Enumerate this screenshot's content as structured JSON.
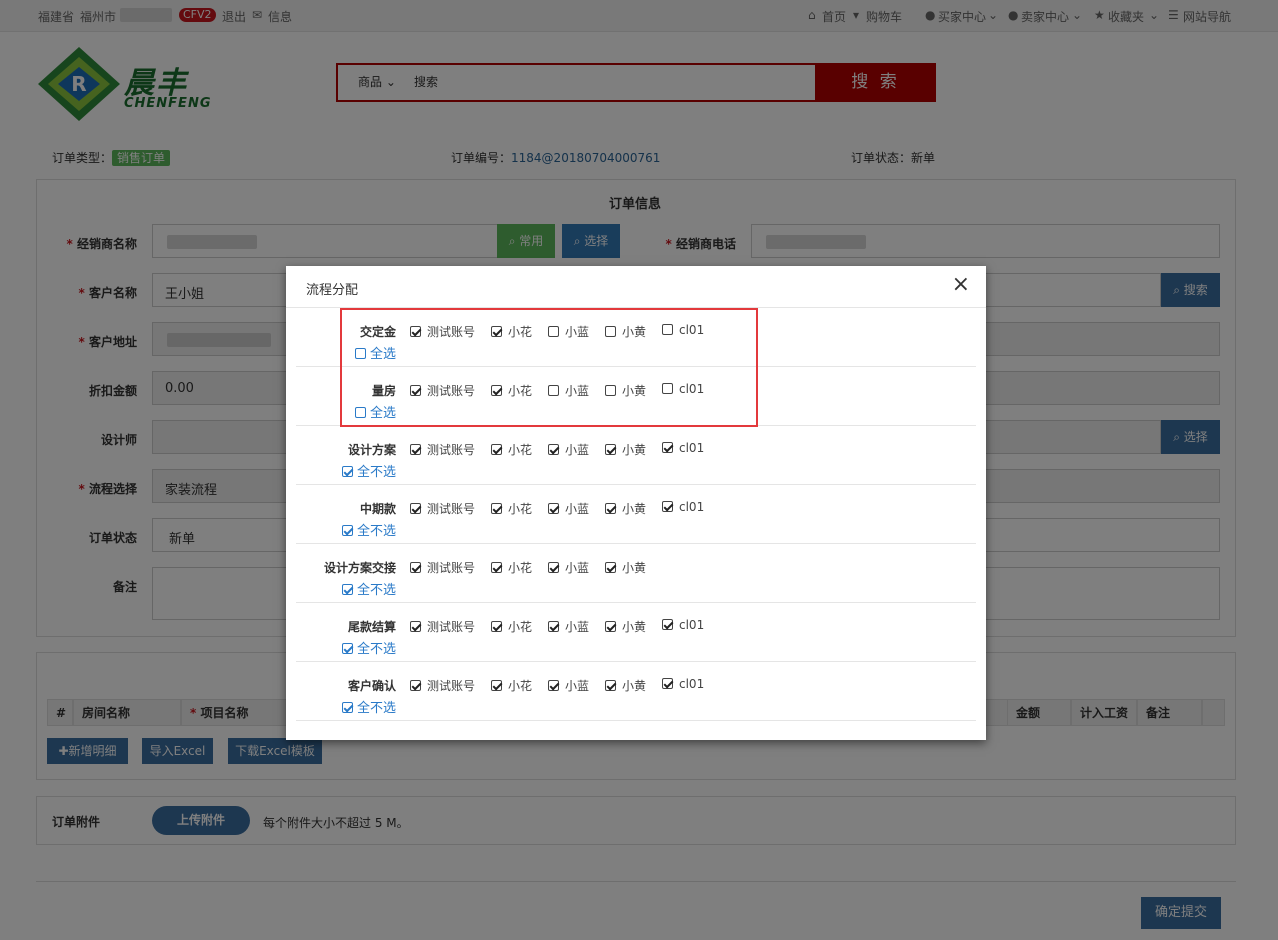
{
  "topbar": {
    "province": "福建省",
    "city": "福州市",
    "badge": "CFV2",
    "logout": "退出",
    "messages": "信息",
    "home": "首页",
    "cart": "购物车",
    "buyer": "买家中心",
    "seller": "卖家中心",
    "favorites": "收藏夹",
    "sitenav": "网站导航"
  },
  "brand": {
    "cn": "晨丰",
    "en": "CHENFENG"
  },
  "search": {
    "category": "商品",
    "placeholder": "搜索",
    "button": "搜 索"
  },
  "order_meta": {
    "type_label": "订单类型：",
    "type_value": "销售订单",
    "no_label": "订单编号：",
    "no_value": "1184@20180704000761",
    "status_label": "订单状态：",
    "status_value": "新单"
  },
  "form": {
    "section_title": "订单信息",
    "dealer_name": "经销商名称",
    "common_btn": "常用",
    "select_btn": "选择",
    "dealer_phone": "经销商电话",
    "customer_name": "客户名称",
    "customer_name_value": "王小姐",
    "search_btn": "搜索",
    "customer_addr": "客户地址",
    "discount": "折扣金额",
    "discount_value": "0.00",
    "designer": "设计师",
    "designer_btn": "选择",
    "flow": "流程选择",
    "flow_value": "家装流程",
    "status": "订单状态",
    "status_value": "新单",
    "remark": "备注"
  },
  "detail_table": {
    "headers": [
      "#",
      "房间名称",
      "项目名称",
      "金额",
      "计入工资",
      "备注"
    ],
    "add_btn": "新增明细",
    "import_btn": "导入Excel",
    "download_btn": "下载Excel模板"
  },
  "attachment": {
    "label": "订单附件",
    "upload_btn": "上传附件",
    "hint": "每个附件大小不超过 5 M。"
  },
  "submit_btn": "确定提交",
  "modal": {
    "title": "流程分配",
    "close": "×",
    "rows": [
      {
        "name": "交定金",
        "toggle": "全选",
        "toggle_on": false,
        "options": [
          {
            "label": "测试账号",
            "on": true
          },
          {
            "label": "小花",
            "on": true
          },
          {
            "label": "小蓝",
            "on": false
          },
          {
            "label": "小黄",
            "on": false
          },
          {
            "label": "cl01",
            "on": false
          }
        ]
      },
      {
        "name": "量房",
        "toggle": "全选",
        "toggle_on": false,
        "options": [
          {
            "label": "测试账号",
            "on": true
          },
          {
            "label": "小花",
            "on": true
          },
          {
            "label": "小蓝",
            "on": false
          },
          {
            "label": "小黄",
            "on": false
          },
          {
            "label": "cl01",
            "on": false
          }
        ]
      },
      {
        "name": "设计方案",
        "toggle": "全不选",
        "toggle_on": true,
        "options": [
          {
            "label": "测试账号",
            "on": true
          },
          {
            "label": "小花",
            "on": true
          },
          {
            "label": "小蓝",
            "on": true
          },
          {
            "label": "小黄",
            "on": true
          },
          {
            "label": "cl01",
            "on": true
          }
        ]
      },
      {
        "name": "中期款",
        "toggle": "全不选",
        "toggle_on": true,
        "options": [
          {
            "label": "测试账号",
            "on": true
          },
          {
            "label": "小花",
            "on": true
          },
          {
            "label": "小蓝",
            "on": true
          },
          {
            "label": "小黄",
            "on": true
          },
          {
            "label": "cl01",
            "on": true
          }
        ]
      },
      {
        "name": "设计方案交接",
        "toggle": "全不选",
        "toggle_on": true,
        "options": [
          {
            "label": "测试账号",
            "on": true
          },
          {
            "label": "小花",
            "on": true
          },
          {
            "label": "小蓝",
            "on": true
          },
          {
            "label": "小黄",
            "on": true
          }
        ]
      },
      {
        "name": "尾款结算",
        "toggle": "全不选",
        "toggle_on": true,
        "options": [
          {
            "label": "测试账号",
            "on": true
          },
          {
            "label": "小花",
            "on": true
          },
          {
            "label": "小蓝",
            "on": true
          },
          {
            "label": "小黄",
            "on": true
          },
          {
            "label": "cl01",
            "on": true
          }
        ]
      },
      {
        "name": "客户确认",
        "toggle": "全不选",
        "toggle_on": true,
        "options": [
          {
            "label": "测试账号",
            "on": true
          },
          {
            "label": "小花",
            "on": true
          },
          {
            "label": "小蓝",
            "on": true
          },
          {
            "label": "小黄",
            "on": true
          },
          {
            "label": "cl01",
            "on": true
          }
        ]
      }
    ]
  }
}
